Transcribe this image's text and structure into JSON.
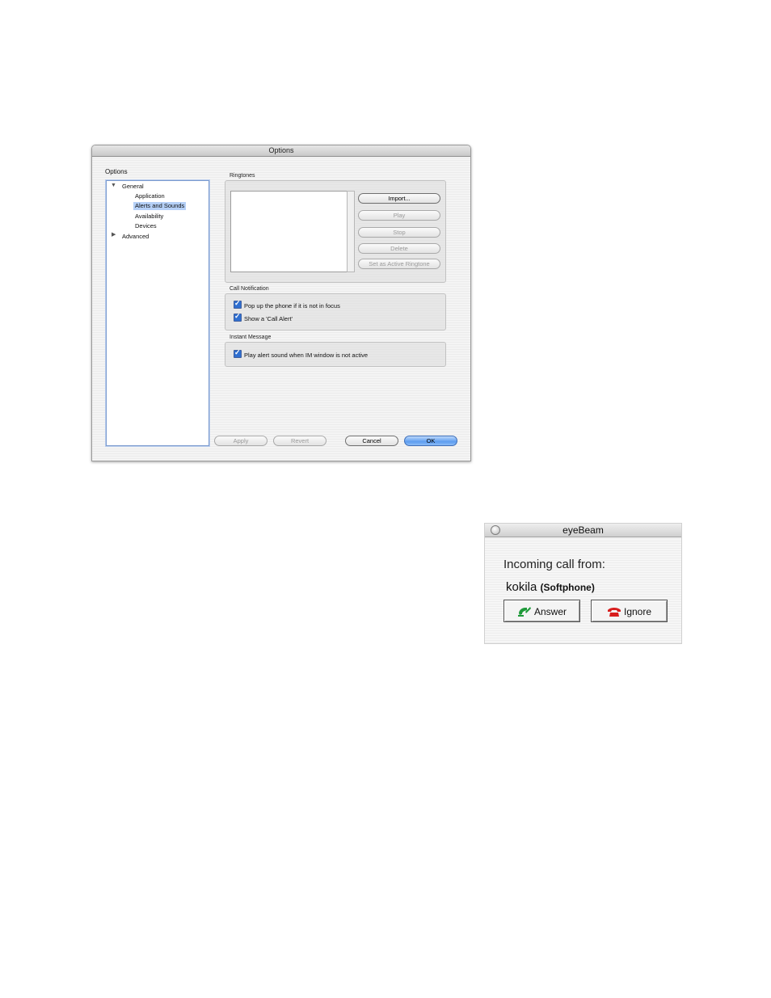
{
  "options_window": {
    "title": "Options",
    "heading": "Options",
    "tree": [
      {
        "label": "General",
        "expanded": true
      },
      {
        "label": "Application"
      },
      {
        "label": "Alerts and Sounds",
        "selected": true
      },
      {
        "label": "Availability"
      },
      {
        "label": "Devices"
      },
      {
        "label": "Advanced",
        "expanded": false
      }
    ],
    "ringtones": {
      "label": "Ringtones",
      "buttons": [
        "Import...",
        "Play",
        "Stop",
        "Delete",
        "Set as Active Ringtone"
      ]
    },
    "call_notification": {
      "label": "Call Notification",
      "checkboxes": [
        {
          "label": "Pop up the phone if it is not in focus",
          "checked": true
        },
        {
          "label": "Show a 'Call Alert'",
          "checked": true
        }
      ]
    },
    "instant_message": {
      "label": "Instant Message",
      "checkboxes": [
        {
          "label": "Play alert sound when IM window is not active",
          "checked": true
        }
      ]
    },
    "footer_buttons": {
      "apply": "Apply",
      "revert": "Revert",
      "cancel": "Cancel",
      "ok": "OK"
    }
  },
  "eyebeam_window": {
    "title": "eyeBeam",
    "incoming_label": "Incoming call from:",
    "caller_name": "kokila",
    "caller_type": "(Softphone)",
    "answer_label": "Answer",
    "ignore_label": "Ignore",
    "answer_icon": "phone-answer-icon",
    "ignore_icon": "phone-hangup-icon",
    "colors": {
      "answer": "#1f9a3a",
      "ignore": "#d81e1e"
    }
  }
}
